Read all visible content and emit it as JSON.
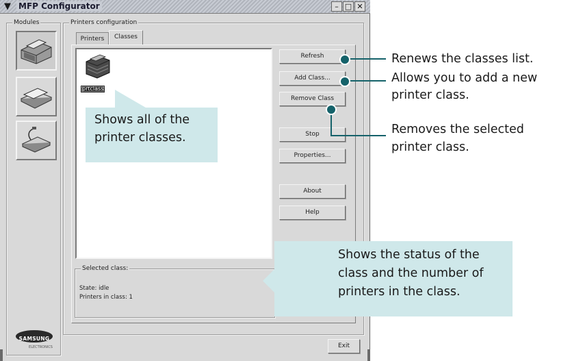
{
  "window": {
    "title": "MFP Configurator",
    "sysmenu_icon": "chevron-down-icon",
    "controls": [
      "minimize-icon",
      "maximize-icon",
      "close-icon"
    ]
  },
  "modules": {
    "label": "Modules",
    "items": [
      {
        "icon": "printer-icon",
        "active": true
      },
      {
        "icon": "scanner-icon",
        "active": false
      },
      {
        "icon": "port-icon",
        "active": false
      }
    ],
    "logo": {
      "brand": "SAMSUNG",
      "sub": "ELECTRONICS"
    }
  },
  "config": {
    "label": "Printers configuration",
    "tabs": [
      {
        "label": "Printers",
        "active": false
      },
      {
        "label": "Classes",
        "active": true
      }
    ]
  },
  "classes_list": {
    "items": [
      {
        "label": "prtclass",
        "icon": "printer-class-icon",
        "selected": true
      }
    ]
  },
  "buttons": {
    "refresh": "Refresh",
    "add_class": "Add Class...",
    "remove_class": "Remove Class",
    "stop": "Stop",
    "properties": "Properties...",
    "about": "About",
    "help": "Help",
    "exit": "Exit"
  },
  "selected_class": {
    "label": "Selected class:",
    "state": "State: idle",
    "printers": "Printers in class: 1"
  },
  "annotations": {
    "refresh": "Renews the classes list.",
    "add_line1": "Allows you to add a new",
    "add_line2": "printer class.",
    "remove_line1": "Removes the selected",
    "remove_line2": "printer class.",
    "list_line1": "Shows all of the",
    "list_line2": "printer classes.",
    "status_line1": "Shows the status of the",
    "status_line2": "class and the number of",
    "status_line3": "printers in the class."
  },
  "colors": {
    "callout_bg": "#cfe8ea",
    "pointer": "#15626a",
    "window_bg": "#d9d9d9"
  }
}
